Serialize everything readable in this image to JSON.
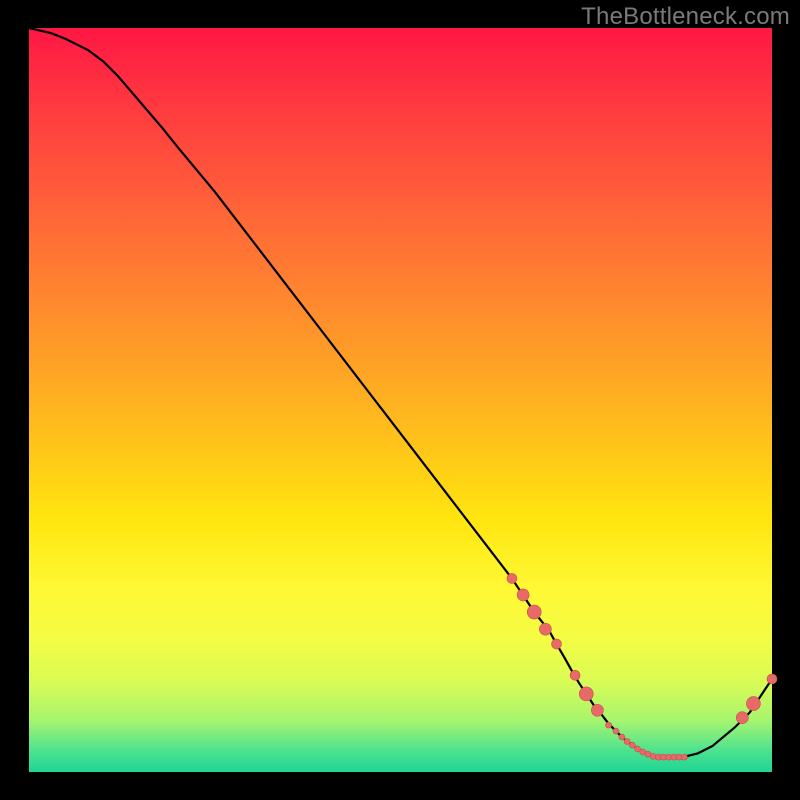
{
  "watermark": "TheBottleneck.com",
  "colors": {
    "curve_stroke": "#000000",
    "marker_fill": "#e86a68",
    "marker_stroke": "#c94d4b",
    "gradient_top": "#ff1744",
    "gradient_bottom": "#1fd596"
  },
  "chart_data": {
    "type": "line",
    "title": "",
    "xlabel": "",
    "ylabel": "",
    "xlim": [
      0,
      100
    ],
    "ylim": [
      0,
      100
    ],
    "grid": false,
    "x": [
      0,
      3,
      5,
      8,
      10,
      12,
      15,
      18,
      20,
      25,
      30,
      35,
      40,
      45,
      50,
      55,
      60,
      65,
      68,
      70,
      71,
      72,
      73,
      74,
      75,
      76,
      77,
      78,
      79,
      80,
      81,
      82,
      83,
      84,
      85,
      86,
      88,
      90,
      92,
      95,
      97,
      99,
      100
    ],
    "y": [
      100,
      99.3,
      98.5,
      97,
      95.5,
      93.5,
      90,
      86.5,
      84,
      78,
      71.5,
      65,
      58.5,
      52,
      45.5,
      39,
      32.5,
      26,
      21.5,
      19,
      17.2,
      15.5,
      13.7,
      12,
      10.5,
      9,
      7.8,
      6.5,
      5.5,
      4.5,
      3.8,
      3,
      2.5,
      2,
      2,
      2,
      2,
      2.5,
      3.5,
      6,
      8,
      11,
      12.5
    ],
    "markers": [
      {
        "x": 65,
        "y": 26,
        "size": 5
      },
      {
        "x": 66.5,
        "y": 23.8,
        "size": 6
      },
      {
        "x": 68,
        "y": 21.5,
        "size": 7
      },
      {
        "x": 69.5,
        "y": 19.2,
        "size": 6
      },
      {
        "x": 71,
        "y": 17.2,
        "size": 5
      },
      {
        "x": 73.5,
        "y": 13,
        "size": 5
      },
      {
        "x": 75,
        "y": 10.5,
        "size": 7
      },
      {
        "x": 76.5,
        "y": 8.3,
        "size": 6
      },
      {
        "x": 78,
        "y": 6.3,
        "size": 3
      },
      {
        "x": 79,
        "y": 5.5,
        "size": 3
      },
      {
        "x": 79.8,
        "y": 4.7,
        "size": 3
      },
      {
        "x": 80.5,
        "y": 4.1,
        "size": 3
      },
      {
        "x": 81.2,
        "y": 3.6,
        "size": 3
      },
      {
        "x": 81.9,
        "y": 3.1,
        "size": 3
      },
      {
        "x": 82.6,
        "y": 2.7,
        "size": 3
      },
      {
        "x": 83.3,
        "y": 2.4,
        "size": 3
      },
      {
        "x": 84,
        "y": 2.1,
        "size": 3
      },
      {
        "x": 84.7,
        "y": 2,
        "size": 3
      },
      {
        "x": 85.4,
        "y": 2,
        "size": 3
      },
      {
        "x": 86.1,
        "y": 2,
        "size": 3
      },
      {
        "x": 86.8,
        "y": 2,
        "size": 3
      },
      {
        "x": 87.5,
        "y": 2,
        "size": 3
      },
      {
        "x": 88.2,
        "y": 2,
        "size": 3
      },
      {
        "x": 96,
        "y": 7.3,
        "size": 6
      },
      {
        "x": 97.5,
        "y": 9.2,
        "size": 7
      },
      {
        "x": 100,
        "y": 12.5,
        "size": 5
      }
    ]
  }
}
